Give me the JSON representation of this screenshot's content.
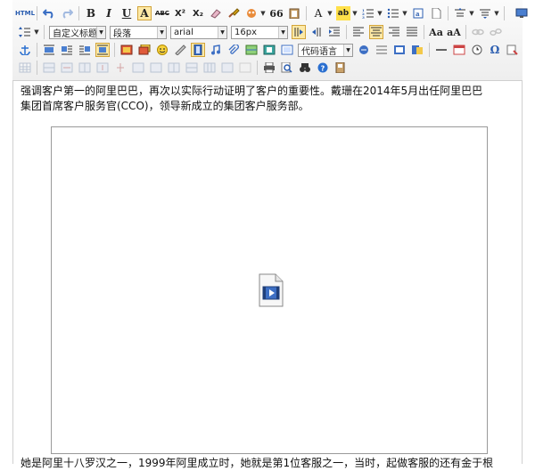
{
  "toolbar": {
    "source_label": "HTML",
    "bold_label": "B",
    "italic_label": "I",
    "underline_label": "U",
    "fontborder_label": "A",
    "strike_label": "ABC",
    "sup_label": "X²",
    "sub_label": "X₂",
    "blockquote_label": "66",
    "forecolor_label": "A",
    "backcolor_label": "ab",
    "heading_select": "自定义标题",
    "paragraph_select": "段落",
    "font_select": "arial",
    "fontsize_select": "16px",
    "code_select": "代码语言",
    "omega_label": "Ω",
    "colors": {
      "accent": "#d2a43b",
      "active_bg": "#fde9a6",
      "toolbar_bg": "#eeeeee"
    }
  },
  "content": {
    "paragraph1": "强调客户第一的阿里巴巴，再次以实际行动证明了客户的重要性。戴珊在2014年5月出任阿里巴巴\n集团首席客户服务官(CCO)，领导新成立的集团客户服务部。",
    "paragraph2": "她是阿里十八罗汉之一，1999年阿里成立时，她就是第1位客服之一，当时，起做客服的还有金于根"
  }
}
